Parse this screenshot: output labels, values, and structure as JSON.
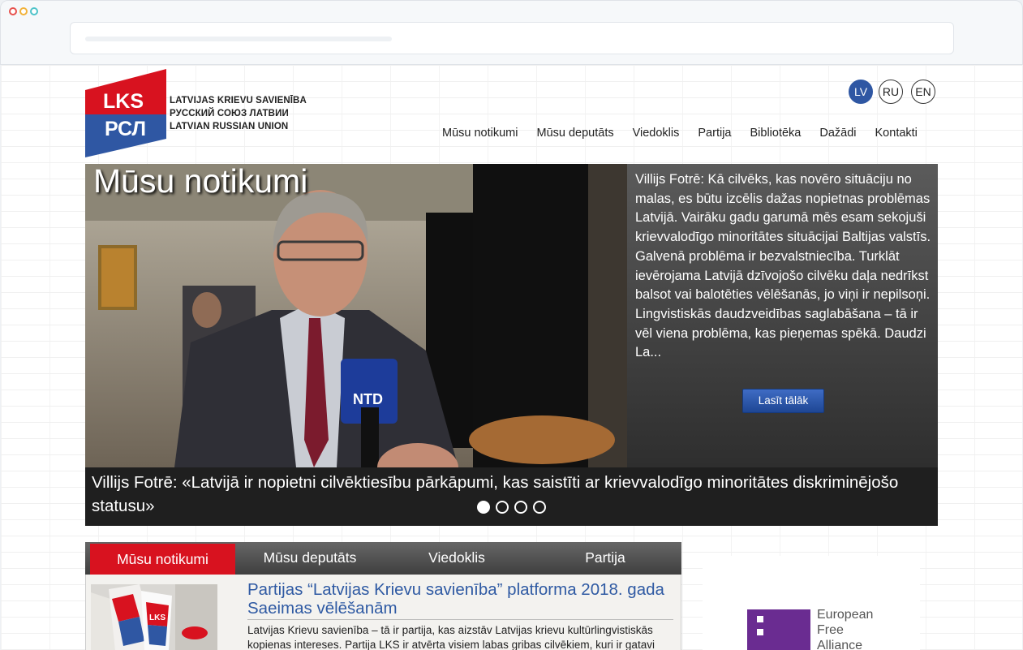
{
  "logo": {
    "top_text": "LKS",
    "bottom_text": "РСЛ",
    "lines": [
      "LATVIJAS KRIEVU SAVIENĪBA",
      "РУССКИЙ СОЮЗ ЛАТВИИ",
      "LATVIAN RUSSIAN UNION"
    ],
    "red": "#d8121f",
    "blue": "#2f57a3"
  },
  "languages": [
    "LV",
    "RU",
    "EN"
  ],
  "active_language": "LV",
  "nav": [
    "Mūsu notikumi",
    "Mūsu deputāts",
    "Viedoklis",
    "Partija",
    "Bibliotēka",
    "Dažādi",
    "Kontakti"
  ],
  "hero": {
    "title": "Mūsu notikumi",
    "excerpt": "Villijs Fotrē: Kā cilvēks, kas novēro situāciju no malas, es būtu izcēlis dažas nopietnas problēmas Latvijā. Vairāku gadu garumā mēs esam sekojuši krievvalodīgo minoritātes situācijai Baltijas valstīs. Galvenā problēma ir bezvalstniecība. Turklāt ievērojama Latvijā dzīvojošo cilvēku daļa nedrīkst balsot vai balotēties vēlēšanās, jo viņi ir nepilsoņi. Lingvistiskās daudzveidības saglabāšana – tā ir vēl viena problēma, kas pieņemas spēkā. Daudzi La...",
    "read_more": "Lasīt tālāk",
    "caption": "Villijs Fotrē: «Latvijā ir nopietni cilvēktiesību pārkāpumi, kas saistīti ar krievvalodīgo minoritātes diskriminējošo statusu»",
    "microphone_label": "NTD",
    "slide_count": 4,
    "active_slide": 1
  },
  "tabs": [
    "Mūsu notikumi",
    "Mūsu deputāts",
    "Viedoklis",
    "Partija"
  ],
  "active_tab": "Mūsu notikumi",
  "news": {
    "title": "Partijas “Latvijas Krievu savienība” platforma 2018. gada Saeimas vēlēšanām",
    "text": "Latvijas Krievu savienība – tā ir partija, kas aizstāv Latvijas krievu kultūrlingvistiskās kopienas intereses. Partija LKS ir atvērta visiem labas gribas cilvēkiem, kuri ir gatavi",
    "flag_text": "LKS"
  },
  "sidebar": {
    "efa_lines": [
      "European",
      "Free",
      "Alliance"
    ],
    "efa_color": "#6a2c91"
  }
}
